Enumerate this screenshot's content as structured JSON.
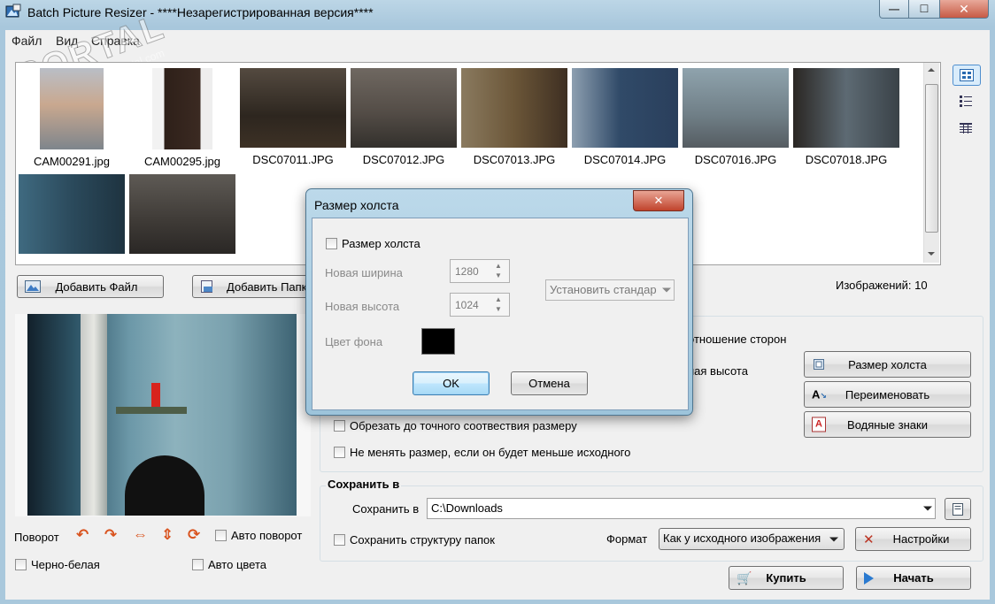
{
  "window": {
    "title": "Batch Picture Resizer - ****Незарегистрированная версия****",
    "min_glyph": "—",
    "max_glyph": "☐",
    "close_glyph": "✕"
  },
  "menu": {
    "items": [
      "Файл",
      "Вид",
      "Справка"
    ]
  },
  "watermark": {
    "text": "PORTAL",
    "sub": "www.softportal.com"
  },
  "thumbnails": [
    {
      "label": "CAM00291.jpg",
      "color": "#8a8f99"
    },
    {
      "label": "CAM00295.jpg",
      "color": "#3b2a22"
    },
    {
      "label": "DSC07011.JPG",
      "color": "#3a3229"
    },
    {
      "label": "DSC07012.JPG",
      "color": "#4b4540"
    },
    {
      "label": "DSC07013.JPG",
      "color": "#5a4a35"
    },
    {
      "label": "DSC07014.JPG",
      "color": "#36506e"
    },
    {
      "label": "DSC07016.JPG",
      "color": "#6f7e86"
    },
    {
      "label": "DSC07018.JPG",
      "color": "#444b52"
    },
    {
      "label": "",
      "color": "#2b4a5c"
    },
    {
      "label": "",
      "color": "#3e3a36"
    }
  ],
  "toolbar": {
    "add_file": "Добавить Файл",
    "add_folder": "Добавить Папку",
    "image_count": "Изображений: 10"
  },
  "preview": {
    "rotate_label": "Поворот",
    "auto_rotate": "Авто поворот",
    "grayscale": "Черно-белая",
    "auto_color": "Авто цвета"
  },
  "resize_options": {
    "aspect_partial": "отношение сторон",
    "height_partial": "ная высота",
    "crop_exact": "Обрезать до точного соотвествия размеру",
    "no_upscale": "Не менять размер, если он будет меньше исходного"
  },
  "side_buttons": {
    "canvas_size": "Размер холста",
    "rename": "Переименовать",
    "watermarks": "Водяные знаки"
  },
  "save": {
    "group_title": "Сохранить в",
    "save_to_label": "Сохранить в",
    "path": "C:\\Downloads",
    "keep_structure": "Сохранить структуру папок",
    "format_label": "Формат",
    "format_value": "Как у исходного изображения",
    "settings": "Настройки"
  },
  "actions": {
    "buy": "Купить",
    "start": "Начать"
  },
  "dialog": {
    "title": "Размер холста",
    "enable_label": "Размер холста",
    "width_label": "Новая ширина",
    "width_value": "1280",
    "height_label": "Новая высота",
    "height_value": "1024",
    "standard_placeholder": "Установить стандар",
    "bg_label": "Цвет фона",
    "bg_color": "#000000",
    "ok": "OK",
    "cancel": "Отмена"
  }
}
